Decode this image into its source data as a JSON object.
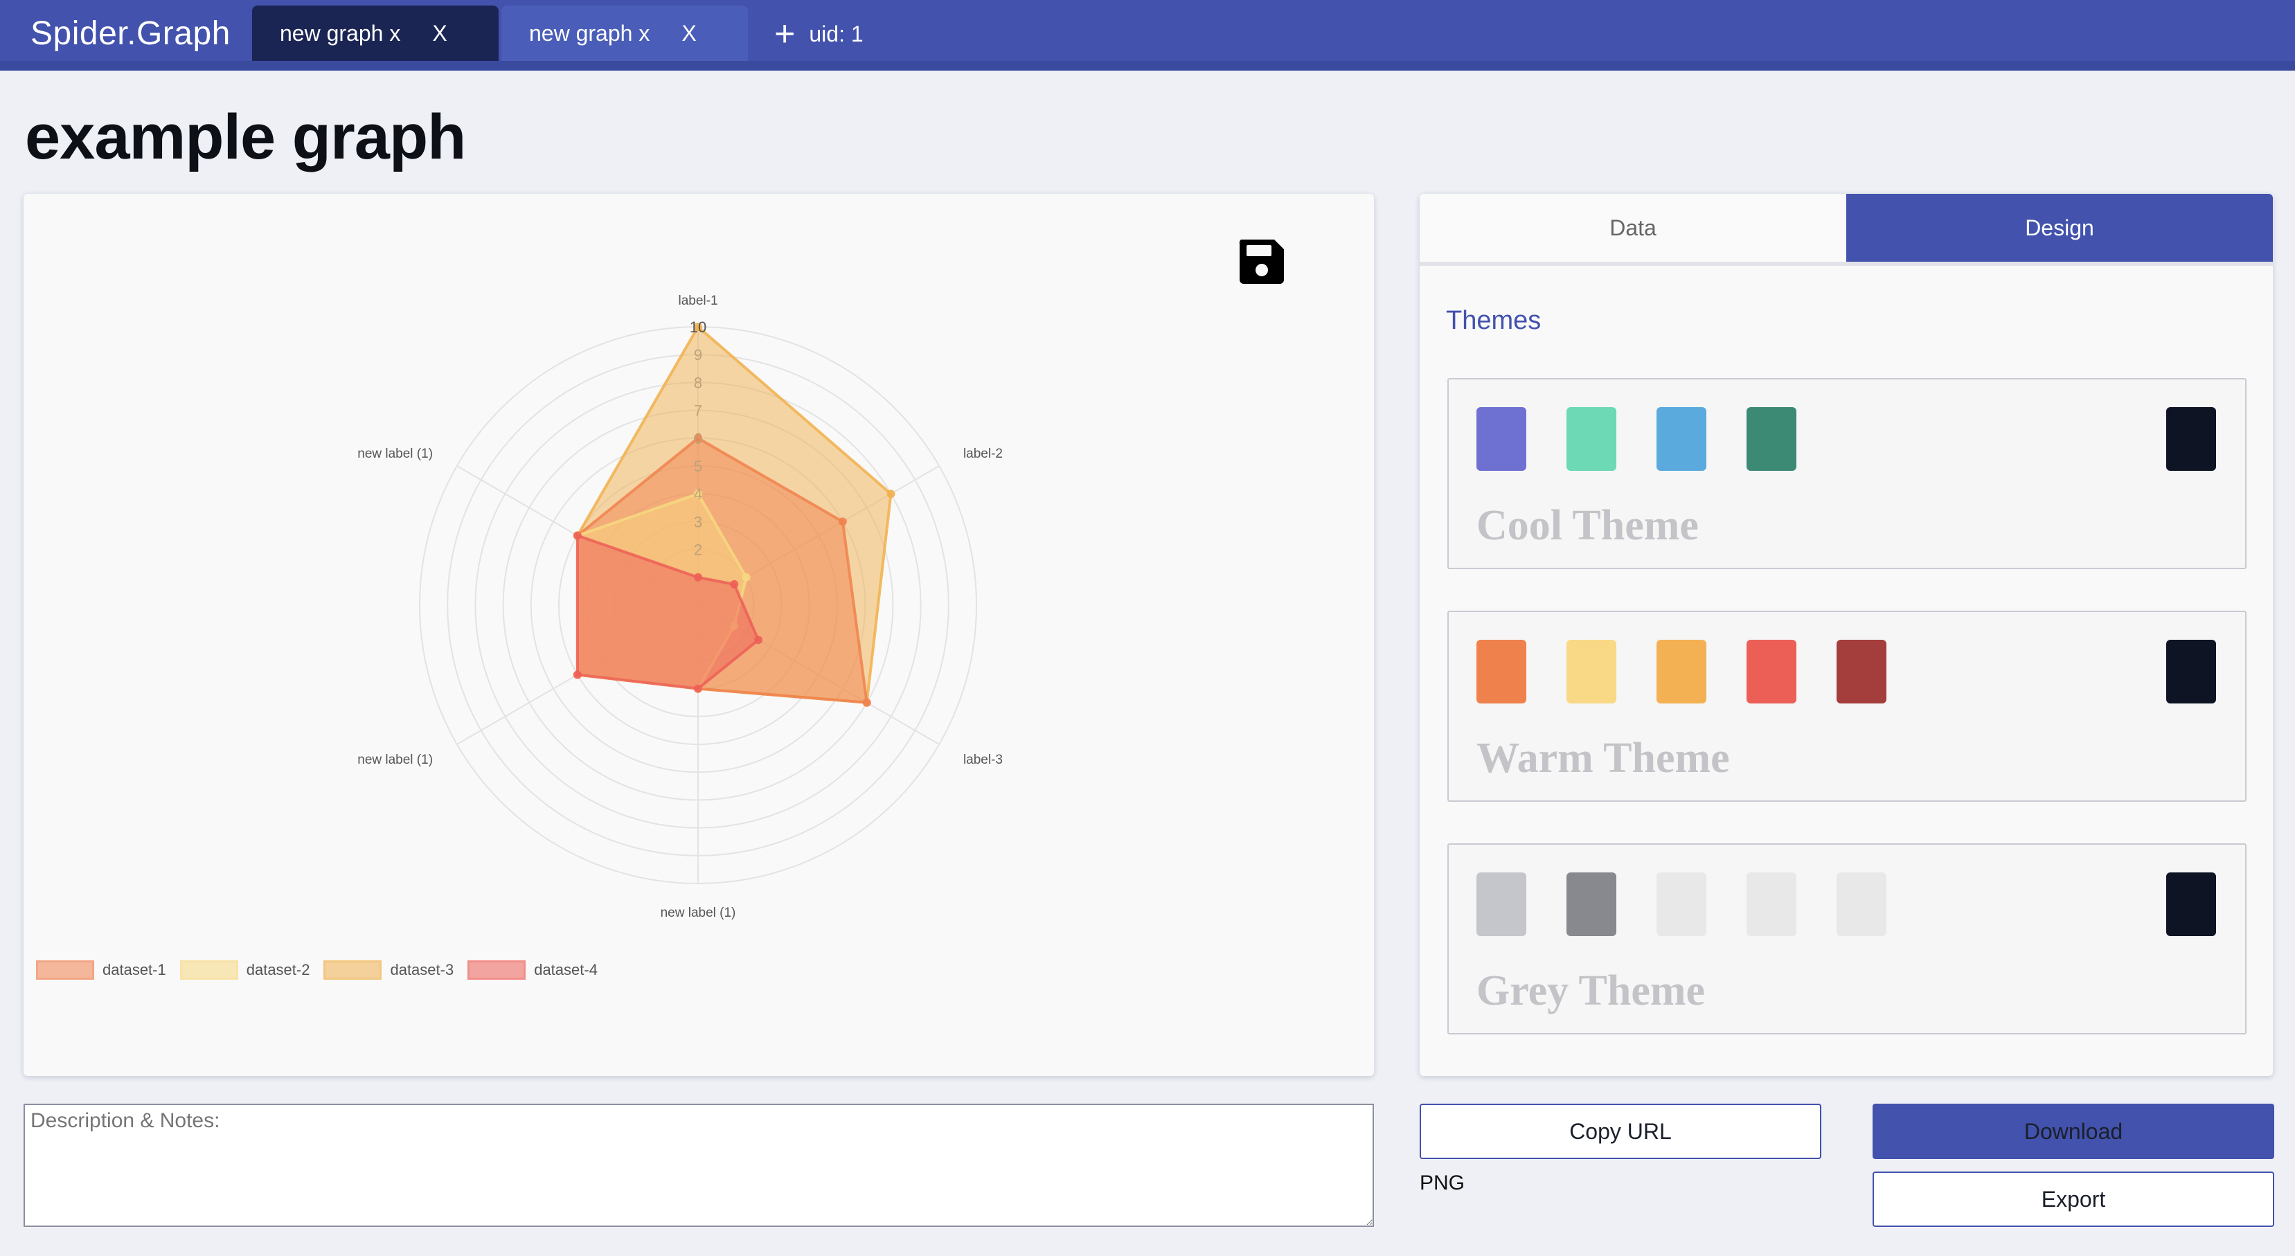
{
  "app": {
    "brand": "Spider.Graph",
    "uid_label": "uid: 1"
  },
  "tabs": [
    {
      "label": "new graph x",
      "close": "X",
      "active": true
    },
    {
      "label": "new graph x",
      "close": "X",
      "active": false
    }
  ],
  "page": {
    "title": "example graph"
  },
  "chart_data": {
    "type": "radar",
    "labels": [
      "label-1",
      "label-2",
      "label-3",
      "new label (1)",
      "new label (1)",
      "new label (1)"
    ],
    "scale_ticks": [
      "2",
      "3",
      "4",
      "5",
      "6",
      "7",
      "8",
      "9",
      "10"
    ],
    "r_max": 10,
    "series": [
      {
        "name": "dataset-1",
        "values": [
          6,
          6,
          7,
          3,
          5,
          5
        ],
        "color": "#f0824f"
      },
      {
        "name": "dataset-2",
        "values": [
          4,
          2,
          1.5,
          3,
          5,
          5
        ],
        "color": "#f7d880"
      },
      {
        "name": "dataset-3",
        "values": [
          10,
          8,
          7,
          3,
          5,
          5
        ],
        "color": "#f1b04d"
      },
      {
        "name": "dataset-4",
        "values": [
          1,
          1.5,
          2.5,
          3,
          5,
          5
        ],
        "color": "#ed5f57"
      }
    ]
  },
  "notes": {
    "placeholder": "Description & Notes:"
  },
  "side": {
    "tab_data": "Data",
    "tab_design": "Design",
    "themes_heading": "Themes",
    "themes": [
      {
        "name": "Cool Theme",
        "colors": [
          "#6e71d1",
          "#6dd9b5",
          "#5aaadd",
          "#3d8a74"
        ],
        "dark": "#0e1424"
      },
      {
        "name": "Warm Theme",
        "colors": [
          "#ef814d",
          "#f9d985",
          "#f4b153",
          "#ec5f57",
          "#a43e3d"
        ],
        "dark": "#0e1424"
      },
      {
        "name": "Grey Theme",
        "colors": [
          "#c5c6cc",
          "#87898e",
          "#e8e8e8",
          "#e8e8e8",
          "#e8e8e8"
        ],
        "dark": "#0e1424"
      }
    ]
  },
  "actions": {
    "copy_url": "Copy URL",
    "download": "Download",
    "export": "Export",
    "format": "PNG"
  }
}
